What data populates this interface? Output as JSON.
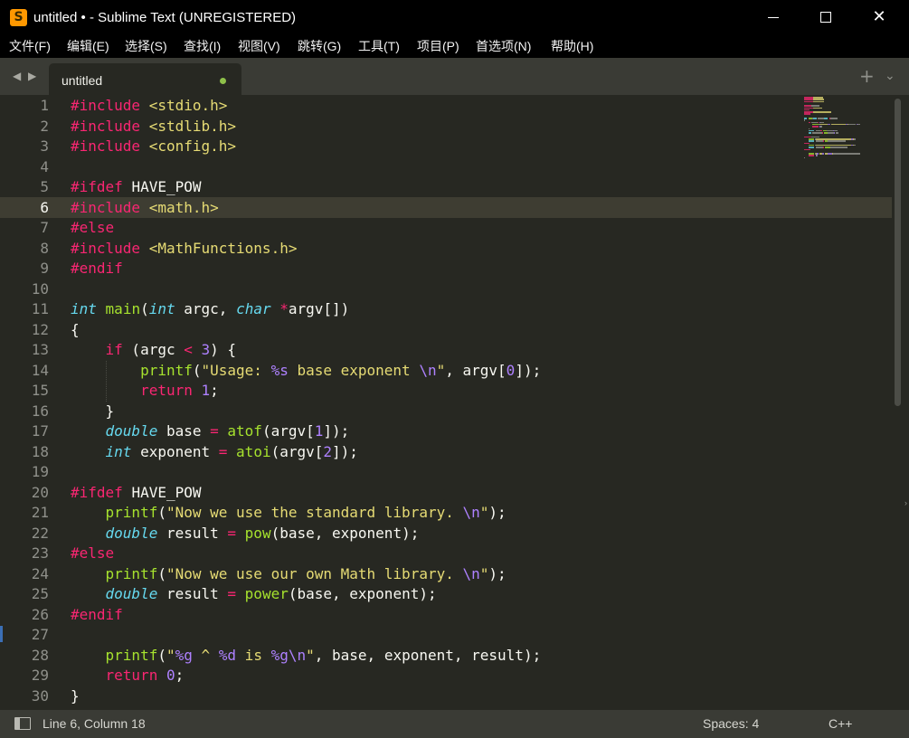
{
  "window": {
    "title": "untitled • - Sublime Text (UNREGISTERED)",
    "icon_name": "sublime-text-icon",
    "controls": {
      "minimize": "minimize-icon",
      "maximize": "maximize-icon",
      "close": "✕"
    }
  },
  "menu": [
    "文件(F)",
    "编辑(E)",
    "选择(S)",
    "查找(I)",
    "视图(V)",
    "跳转(G)",
    "工具(T)",
    "项目(P)",
    "首选项(N)",
    "帮助(H)"
  ],
  "tabbar": {
    "nav_left": "◀",
    "nav_right": "▶",
    "tab_label": "untitled",
    "tab_dirty": true,
    "new_tab": "+",
    "more": "⌄"
  },
  "editor": {
    "active_line": 6,
    "line_numbers": [
      "1",
      "2",
      "3",
      "4",
      "5",
      "6",
      "7",
      "8",
      "9",
      "10",
      "11",
      "12",
      "13",
      "14",
      "15",
      "16",
      "17",
      "18",
      "19",
      "20",
      "21",
      "22",
      "23",
      "24",
      "25",
      "26",
      "27",
      "28",
      "29",
      "30"
    ],
    "code": [
      [
        [
          "pp",
          "#include "
        ],
        [
          "str",
          "<stdio.h>"
        ]
      ],
      [
        [
          "pp",
          "#include "
        ],
        [
          "str",
          "<stdlib.h>"
        ]
      ],
      [
        [
          "pp",
          "#include "
        ],
        [
          "str",
          "<config.h>"
        ]
      ],
      [],
      [
        [
          "pp",
          "#ifdef "
        ],
        [
          "plain",
          "HAVE_POW"
        ]
      ],
      [
        [
          "pp",
          "#include "
        ],
        [
          "str",
          "<math.h>"
        ]
      ],
      [
        [
          "pp",
          "#else"
        ]
      ],
      [
        [
          "pp",
          "#include "
        ],
        [
          "str",
          "<MathFunctions.h>"
        ]
      ],
      [
        [
          "pp",
          "#endif"
        ]
      ],
      [],
      [
        [
          "type",
          "int"
        ],
        [
          "plain",
          " "
        ],
        [
          "fn",
          "main"
        ],
        [
          "plain",
          "("
        ],
        [
          "type",
          "int"
        ],
        [
          "plain",
          " argc, "
        ],
        [
          "type",
          "char"
        ],
        [
          "plain",
          " "
        ],
        [
          "op",
          "*"
        ],
        [
          "plain",
          "argv[])"
        ]
      ],
      [
        [
          "plain",
          "{"
        ]
      ],
      [
        [
          "plain",
          "    "
        ],
        [
          "kw",
          "if"
        ],
        [
          "plain",
          " (argc "
        ],
        [
          "op",
          "<"
        ],
        [
          "plain",
          " "
        ],
        [
          "num",
          "3"
        ],
        [
          "plain",
          ") {"
        ]
      ],
      [
        [
          "plain",
          "        "
        ],
        [
          "fn",
          "printf"
        ],
        [
          "plain",
          "("
        ],
        [
          "str",
          "\"Usage: "
        ],
        [
          "esc",
          "%s"
        ],
        [
          "str",
          " base exponent "
        ],
        [
          "esc",
          "\\n"
        ],
        [
          "str",
          "\""
        ],
        [
          "plain",
          ", argv["
        ],
        [
          "num",
          "0"
        ],
        [
          "plain",
          "]);"
        ]
      ],
      [
        [
          "plain",
          "        "
        ],
        [
          "kw",
          "return"
        ],
        [
          "plain",
          " "
        ],
        [
          "num",
          "1"
        ],
        [
          "plain",
          ";"
        ]
      ],
      [
        [
          "plain",
          "    }"
        ]
      ],
      [
        [
          "plain",
          "    "
        ],
        [
          "type",
          "double"
        ],
        [
          "plain",
          " base "
        ],
        [
          "op",
          "="
        ],
        [
          "plain",
          " "
        ],
        [
          "fn",
          "atof"
        ],
        [
          "plain",
          "(argv["
        ],
        [
          "num",
          "1"
        ],
        [
          "plain",
          "]);"
        ]
      ],
      [
        [
          "plain",
          "    "
        ],
        [
          "type",
          "int"
        ],
        [
          "plain",
          " exponent "
        ],
        [
          "op",
          "="
        ],
        [
          "plain",
          " "
        ],
        [
          "fn",
          "atoi"
        ],
        [
          "plain",
          "(argv["
        ],
        [
          "num",
          "2"
        ],
        [
          "plain",
          "]);"
        ]
      ],
      [],
      [
        [
          "pp",
          "#ifdef "
        ],
        [
          "plain",
          "HAVE_POW"
        ]
      ],
      [
        [
          "plain",
          "    "
        ],
        [
          "fn",
          "printf"
        ],
        [
          "plain",
          "("
        ],
        [
          "str",
          "\"Now we use the standard library. "
        ],
        [
          "esc",
          "\\n"
        ],
        [
          "str",
          "\""
        ],
        [
          "plain",
          ");"
        ]
      ],
      [
        [
          "plain",
          "    "
        ],
        [
          "type",
          "double"
        ],
        [
          "plain",
          " result "
        ],
        [
          "op",
          "="
        ],
        [
          "plain",
          " "
        ],
        [
          "fn",
          "pow"
        ],
        [
          "plain",
          "(base, exponent);"
        ]
      ],
      [
        [
          "pp",
          "#else"
        ]
      ],
      [
        [
          "plain",
          "    "
        ],
        [
          "fn",
          "printf"
        ],
        [
          "plain",
          "("
        ],
        [
          "str",
          "\"Now we use our own Math library. "
        ],
        [
          "esc",
          "\\n"
        ],
        [
          "str",
          "\""
        ],
        [
          "plain",
          ");"
        ]
      ],
      [
        [
          "plain",
          "    "
        ],
        [
          "type",
          "double"
        ],
        [
          "plain",
          " result "
        ],
        [
          "op",
          "="
        ],
        [
          "plain",
          " "
        ],
        [
          "fn",
          "power"
        ],
        [
          "plain",
          "(base, exponent);"
        ]
      ],
      [
        [
          "pp",
          "#endif"
        ]
      ],
      [],
      [
        [
          "plain",
          "    "
        ],
        [
          "fn",
          "printf"
        ],
        [
          "plain",
          "("
        ],
        [
          "str",
          "\""
        ],
        [
          "esc",
          "%g"
        ],
        [
          "str",
          " ^ "
        ],
        [
          "esc",
          "%d"
        ],
        [
          "str",
          " is "
        ],
        [
          "esc",
          "%g"
        ],
        [
          "esc",
          "\\n"
        ],
        [
          "str",
          "\""
        ],
        [
          "plain",
          ", base, exponent, result);"
        ]
      ],
      [
        [
          "plain",
          "    "
        ],
        [
          "kw",
          "return"
        ],
        [
          "plain",
          " "
        ],
        [
          "num",
          "0"
        ],
        [
          "plain",
          ";"
        ]
      ],
      [
        [
          "plain",
          "}"
        ]
      ]
    ]
  },
  "statusbar": {
    "position": "Line 6, Column 18",
    "indentation": "Spaces: 4",
    "syntax": "C++"
  },
  "colors": {
    "background": "#272822",
    "preprocessor": "#f92672",
    "string": "#e6db74",
    "type": "#66d9ef",
    "function": "#a6e22e",
    "number": "#ae81ff",
    "plain": "#f8f8f2",
    "dirty_dot": "#8ec04a"
  }
}
